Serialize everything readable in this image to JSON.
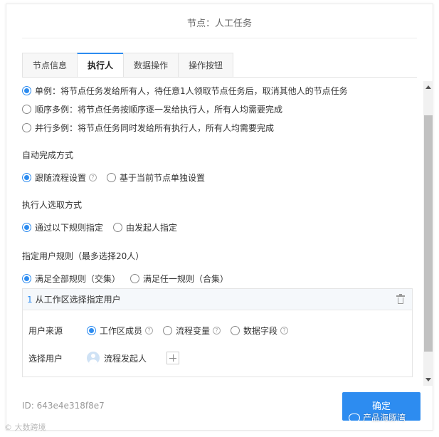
{
  "dialog": {
    "title": "节点：人工任务"
  },
  "tabs": [
    {
      "label": "节点信息"
    },
    {
      "label": "执行人"
    },
    {
      "label": "数据操作"
    },
    {
      "label": "操作按钮"
    }
  ],
  "mode_options": [
    {
      "label": "单例：将节点任务发给所有人，待任意1人领取节点任务后，取消其他人的节点任务",
      "checked": true
    },
    {
      "label": "顺序多例：将节点任务按顺序逐一发给执行人，所有人均需要完成",
      "checked": false
    },
    {
      "label": "并行多例：将节点任务同时发给所有执行人，所有人均需要完成",
      "checked": false
    }
  ],
  "auto_complete": {
    "title": "自动完成方式",
    "options": [
      {
        "label": "跟随流程设置",
        "checked": true,
        "help": "?"
      },
      {
        "label": "基于当前节点单独设置",
        "checked": false
      }
    ]
  },
  "executor_select": {
    "title": "执行人选取方式",
    "options": [
      {
        "label": "通过以下规则指定",
        "checked": true
      },
      {
        "label": "由发起人指定",
        "checked": false
      }
    ]
  },
  "user_rules": {
    "title": "指定用户规则（最多选择20人）",
    "options": [
      {
        "label": "满足全部规则（交集）",
        "checked": true
      },
      {
        "label": "满足任一规则（合集）",
        "checked": false
      }
    ]
  },
  "rule": {
    "number": "1",
    "title": "从工作区选择指定用户",
    "source_label": "用户来源",
    "source_options": [
      {
        "label": "工作区成员",
        "checked": true,
        "help": "?"
      },
      {
        "label": "流程变量",
        "checked": false,
        "help": "?"
      },
      {
        "label": "数据字段",
        "checked": false,
        "help": "?"
      }
    ],
    "select_label": "选择用户",
    "selected_user": "流程发起人"
  },
  "footer": {
    "id_text": "ID: 643e4e318f8e7",
    "confirm_label": "确定"
  },
  "watermarks": {
    "left": "© 大数跨境",
    "right": "产品海豚湾"
  },
  "colors": {
    "accent": "#2d8cf0"
  }
}
